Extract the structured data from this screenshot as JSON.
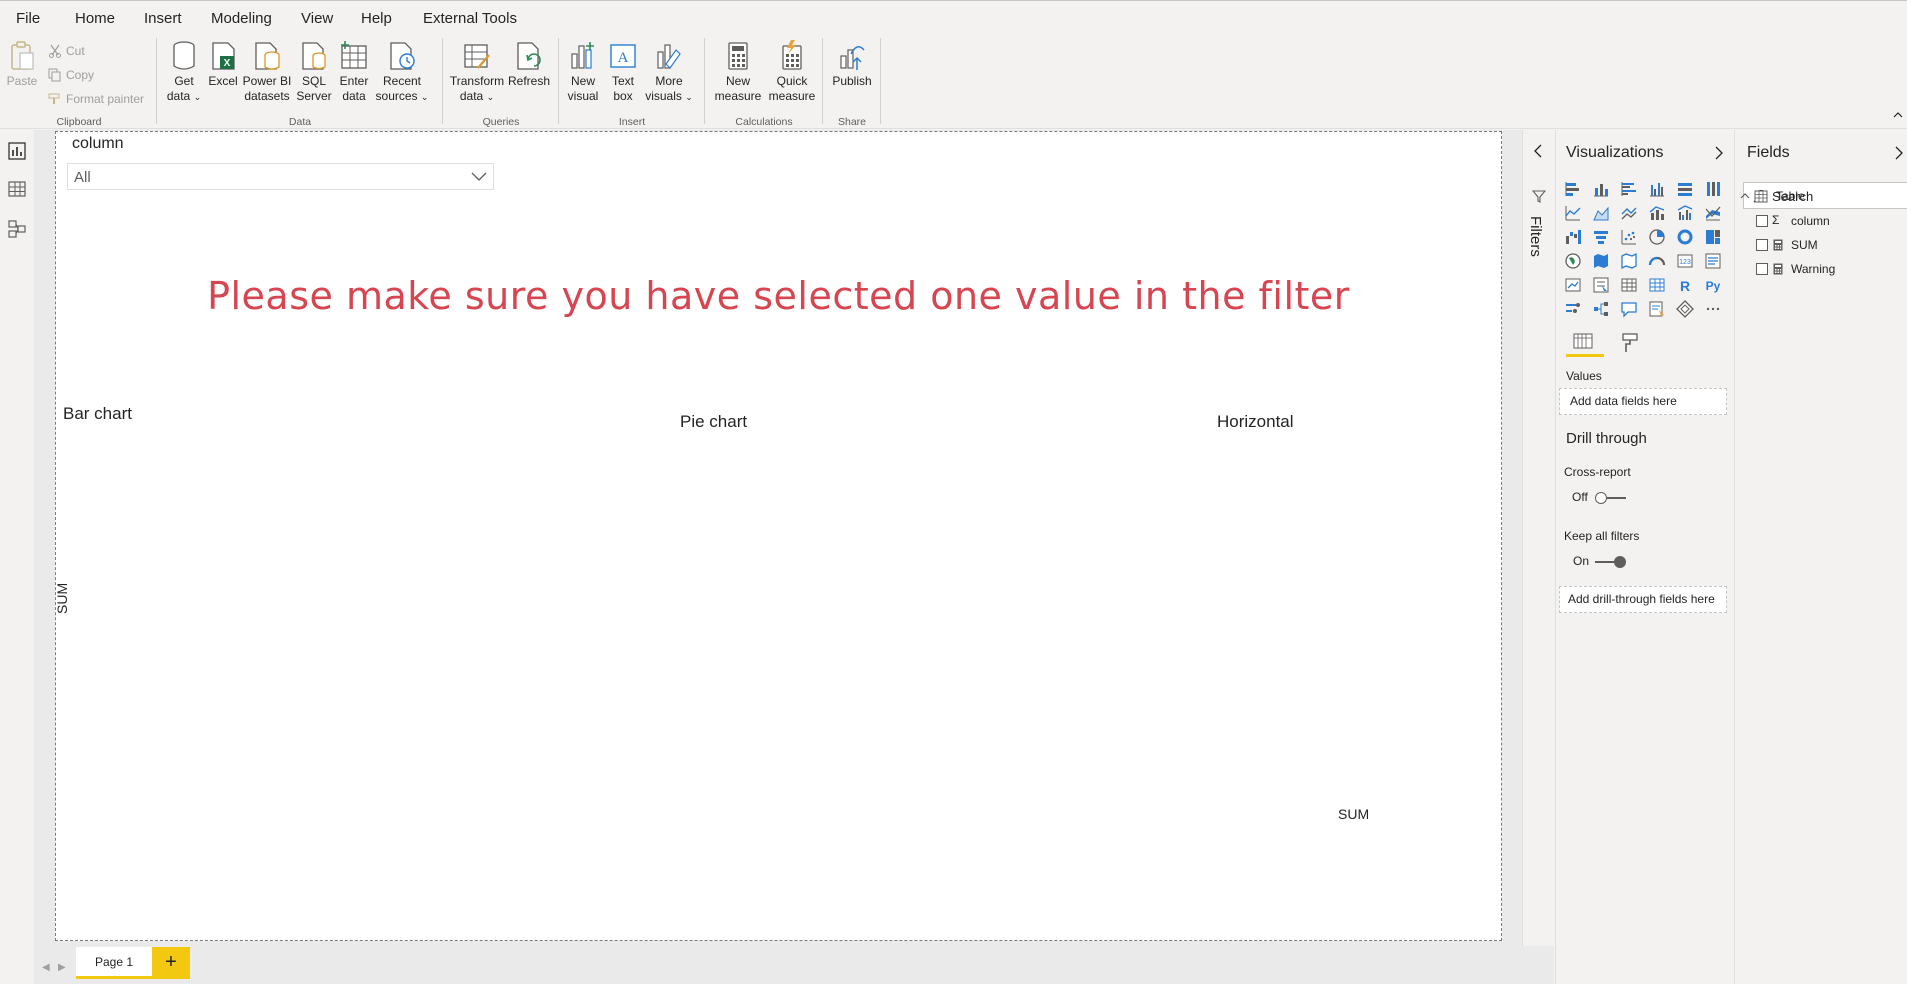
{
  "menu": {
    "file": "File",
    "home": "Home",
    "insert": "Insert",
    "modeling": "Modeling",
    "view": "View",
    "help": "Help",
    "external_tools": "External Tools"
  },
  "ribbon": {
    "clipboard": {
      "label": "Clipboard",
      "paste": "Paste",
      "cut": "Cut",
      "copy": "Copy",
      "format_painter": "Format painter"
    },
    "data": {
      "label": "Data",
      "get_data_1": "Get",
      "get_data_2": "data",
      "excel": "Excel",
      "powerbi_1": "Power BI",
      "powerbi_2": "datasets",
      "sql_1": "SQL",
      "sql_2": "Server",
      "enter_1": "Enter",
      "enter_2": "data",
      "recent_1": "Recent",
      "recent_2": "sources"
    },
    "queries": {
      "label": "Queries",
      "transform_1": "Transform",
      "transform_2": "data",
      "refresh": "Refresh"
    },
    "insert": {
      "label": "Insert",
      "new_visual_1": "New",
      "new_visual_2": "visual",
      "text_box_1": "Text",
      "text_box_2": "box",
      "more_visuals_1": "More",
      "more_visuals_2": "visuals"
    },
    "calculations": {
      "label": "Calculations",
      "new_measure_1": "New",
      "new_measure_2": "measure",
      "quick_measure_1": "Quick",
      "quick_measure_2": "measure"
    },
    "share": {
      "label": "Share",
      "publish": "Publish"
    }
  },
  "canvas": {
    "slicer_title": "column",
    "slicer_value": "All",
    "warning": "Please make sure you have selected one value in the filter",
    "bar_chart_title": "Bar chart",
    "pie_chart_title": "Pie chart",
    "horizontal_title": "Horizontal",
    "bar_y_label": "SUM",
    "horizontal_x_label": "SUM"
  },
  "pages": {
    "tab1": "Page 1",
    "add": "+"
  },
  "filters": {
    "label": "Filters"
  },
  "visualizations": {
    "title": "Visualizations",
    "values_label": "Values",
    "values_well": "Add data fields here",
    "drill_title": "Drill through",
    "cross_report": "Cross-report",
    "cross_state": "Off",
    "keep_filters": "Keep all filters",
    "keep_state": "On",
    "drill_well": "Add drill-through fields here"
  },
  "fields": {
    "title": "Fields",
    "search_placeholder": "Search",
    "table_name": "Table",
    "items": [
      {
        "name": "column",
        "kind": "sigma"
      },
      {
        "name": "SUM",
        "kind": "calculator"
      },
      {
        "name": "Warning",
        "kind": "calculator"
      }
    ]
  },
  "colors": {
    "accent": "#f2c811",
    "warning_text": "#d64550",
    "icon_blue": "#2b7cd3"
  }
}
